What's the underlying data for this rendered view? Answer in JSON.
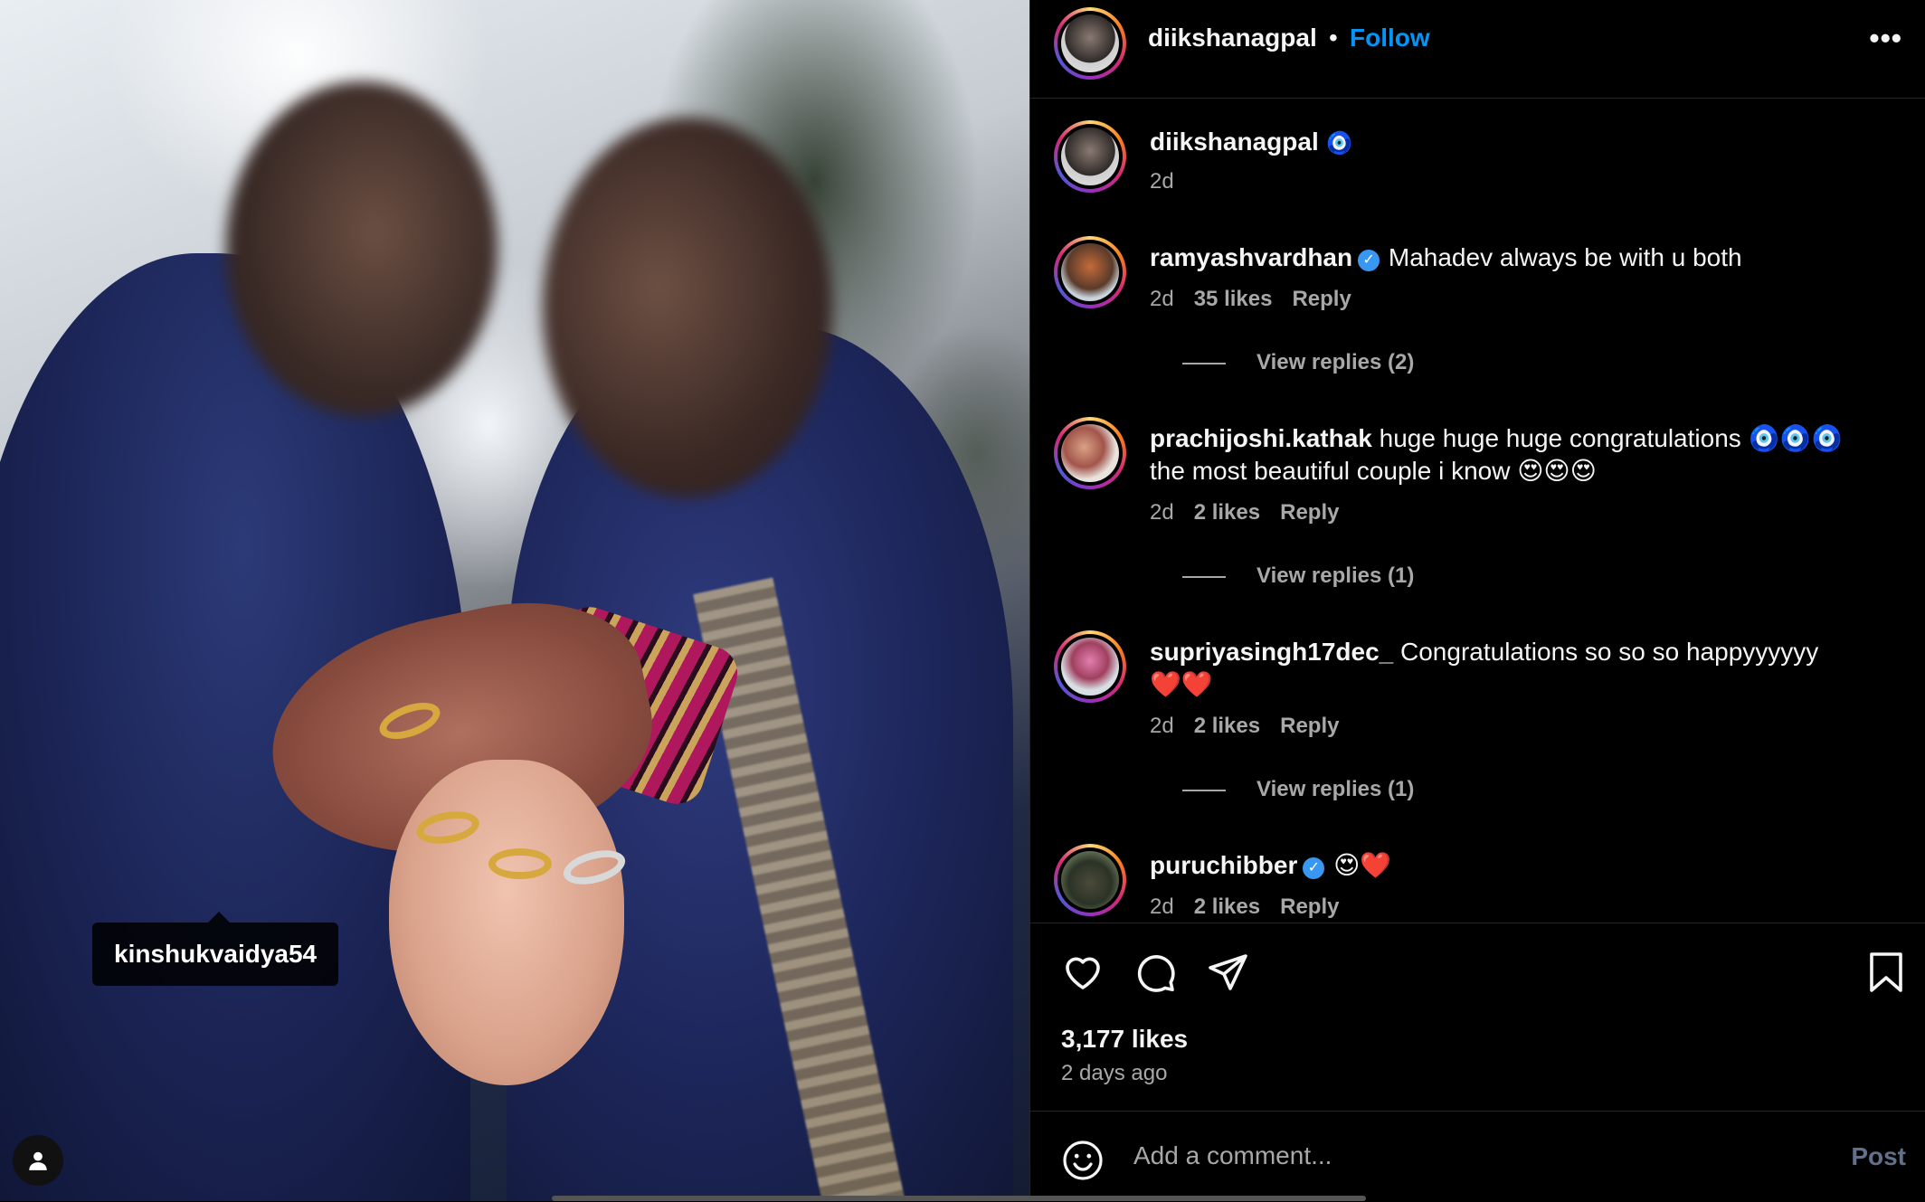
{
  "post_image": {
    "tagged_user": "kinshukvaidya54"
  },
  "header": {
    "username": "diikshanagpal",
    "separator": "•",
    "follow_label": "Follow",
    "more_label": "•••"
  },
  "caption": {
    "username": "diikshanagpal",
    "badge": "🧿",
    "time": "2d"
  },
  "comments": [
    {
      "username": "ramyashvardhan",
      "verified": true,
      "text": "Mahadev always be with u both",
      "time": "2d",
      "likes": "35 likes",
      "reply_label": "Reply",
      "view_replies": "View replies (2)"
    },
    {
      "username": "prachijoshi.kathak",
      "verified": false,
      "text": "huge huge huge congratulations 🧿🧿🧿 the most beautiful couple i know 😍😍😍",
      "time": "2d",
      "likes": "2 likes",
      "reply_label": "Reply",
      "view_replies": "View replies (1)"
    },
    {
      "username": "supriyasingh17dec_",
      "verified": false,
      "text": "Congratulations so so so happyyyyyy ❤️❤️",
      "time": "2d",
      "likes": "2 likes",
      "reply_label": "Reply",
      "view_replies": "View replies (1)"
    },
    {
      "username": "puruchibber",
      "verified": true,
      "text": "😍❤️",
      "time": "2d",
      "likes": "2 likes",
      "reply_label": "Reply"
    }
  ],
  "actions": {
    "likes_count": "3,177 likes",
    "posted_ago": "2 days ago"
  },
  "add_comment": {
    "placeholder": "Add a comment...",
    "post_label": "Post"
  },
  "colors": {
    "background": "#000000",
    "link_blue": "#0095f6",
    "muted_text": "#a8a8a8",
    "post_disabled": "#62708a"
  },
  "icons": [
    "heart-icon",
    "comment-icon",
    "share-icon",
    "bookmark-icon",
    "emoji-icon",
    "more-icon",
    "user-tag-icon",
    "verified-badge-icon"
  ]
}
